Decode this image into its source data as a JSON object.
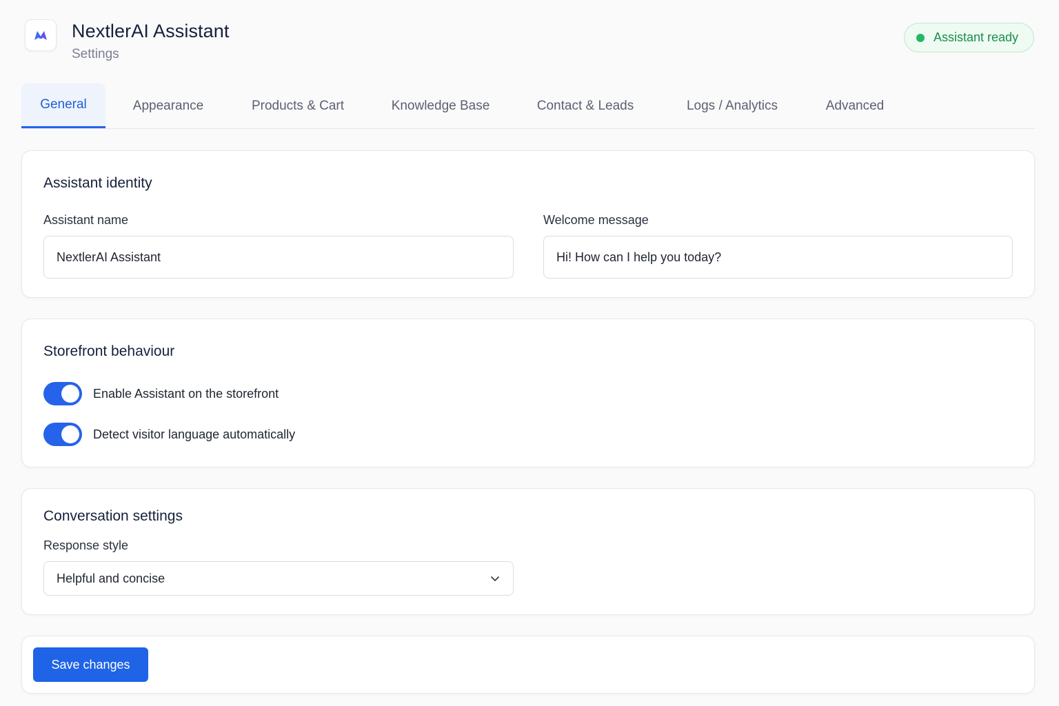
{
  "header": {
    "logo_icon": "nextlerai-logo-icon",
    "title": "NextlerAI Assistant",
    "subtitle": "Settings",
    "status": {
      "text": "Assistant ready",
      "color": "#22b865"
    }
  },
  "tabs": [
    {
      "label": "General",
      "active": true
    },
    {
      "label": "Appearance",
      "active": false
    },
    {
      "label": "Products & Cart",
      "active": false
    },
    {
      "label": "Knowledge Base",
      "active": false
    },
    {
      "label": "Contact & Leads",
      "active": false
    },
    {
      "label": "Logs / Analytics",
      "active": false
    },
    {
      "label": "Advanced",
      "active": false
    }
  ],
  "identity": {
    "title": "Assistant identity",
    "name_label": "Assistant name",
    "name_value": "NextlerAI Assistant",
    "welcome_label": "Welcome message",
    "welcome_value": "Hi! How can I help you today?"
  },
  "storefront": {
    "title": "Storefront behaviour",
    "toggles": [
      {
        "label": "Enable Assistant on the storefront",
        "on": true
      },
      {
        "label": "Detect visitor language automatically",
        "on": true
      }
    ]
  },
  "conversation": {
    "title": "Conversation settings",
    "style_label": "Response style",
    "style_value": "Helpful and concise",
    "style_icon": "chevron-down-icon"
  },
  "actions": {
    "save_label": "Save changes"
  },
  "colors": {
    "accent": "#2563eb",
    "save_button": "#1f63e6",
    "status_green": "#22b865"
  }
}
